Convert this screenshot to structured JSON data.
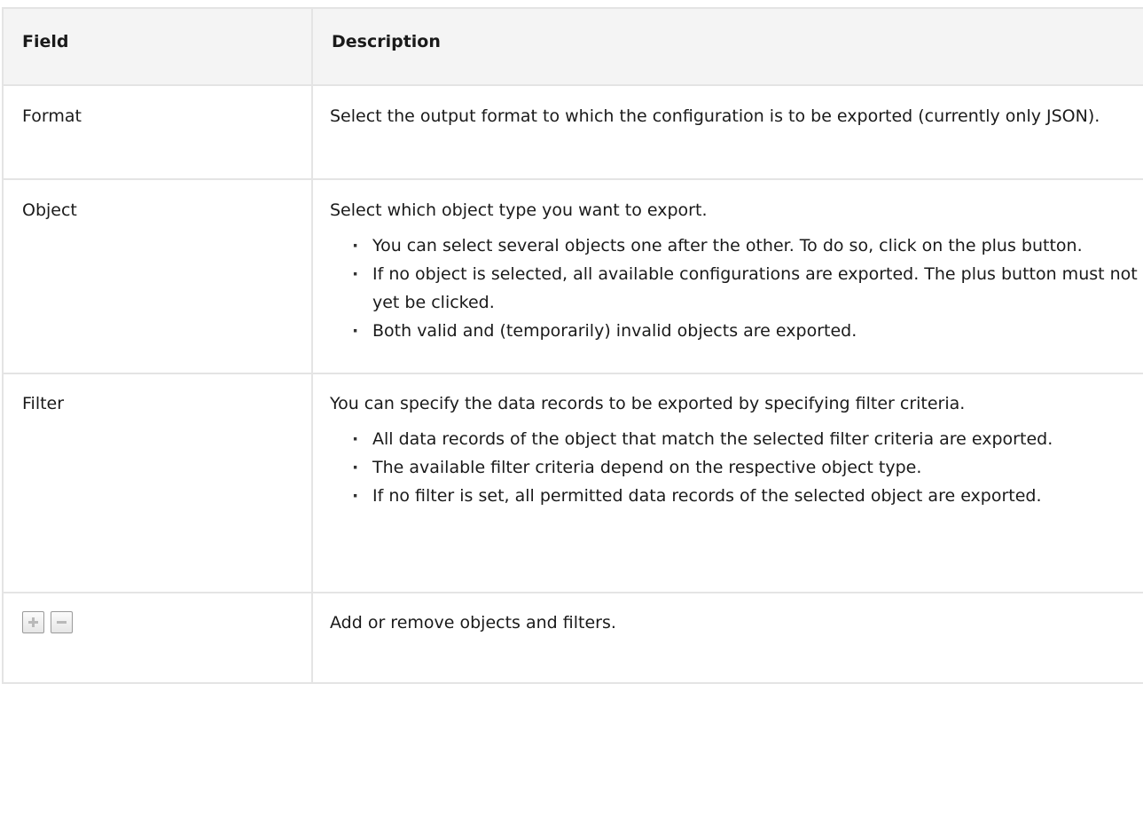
{
  "table": {
    "headers": {
      "field": "Field",
      "description": "Description"
    },
    "rows": [
      {
        "field": "Format",
        "intro": "Select the output format to which the configuration is to be exported (currently only JSON).",
        "bullets": []
      },
      {
        "field": "Object",
        "intro": "Select which object type you want to export.",
        "bullets": [
          "You can select several objects one after the other. To do so, click on the plus button.",
          "If no object is selected, all available configurations are exported. The plus button must not yet be clicked.",
          "Both valid and (temporarily) invalid objects are exported."
        ]
      },
      {
        "field": "Filter",
        "intro": "You can specify the data records to be exported by specifying filter criteria.",
        "bullets": [
          "All data records of the object that match the selected filter criteria are exported.",
          "The available filter criteria depend on the respective object type.",
          "If no filter is set, all permitted data records of the selected object are exported."
        ]
      },
      {
        "field_icons": [
          "plus-icon",
          "minus-icon"
        ],
        "intro": "Add or remove objects and filters.",
        "bullets": []
      }
    ]
  }
}
